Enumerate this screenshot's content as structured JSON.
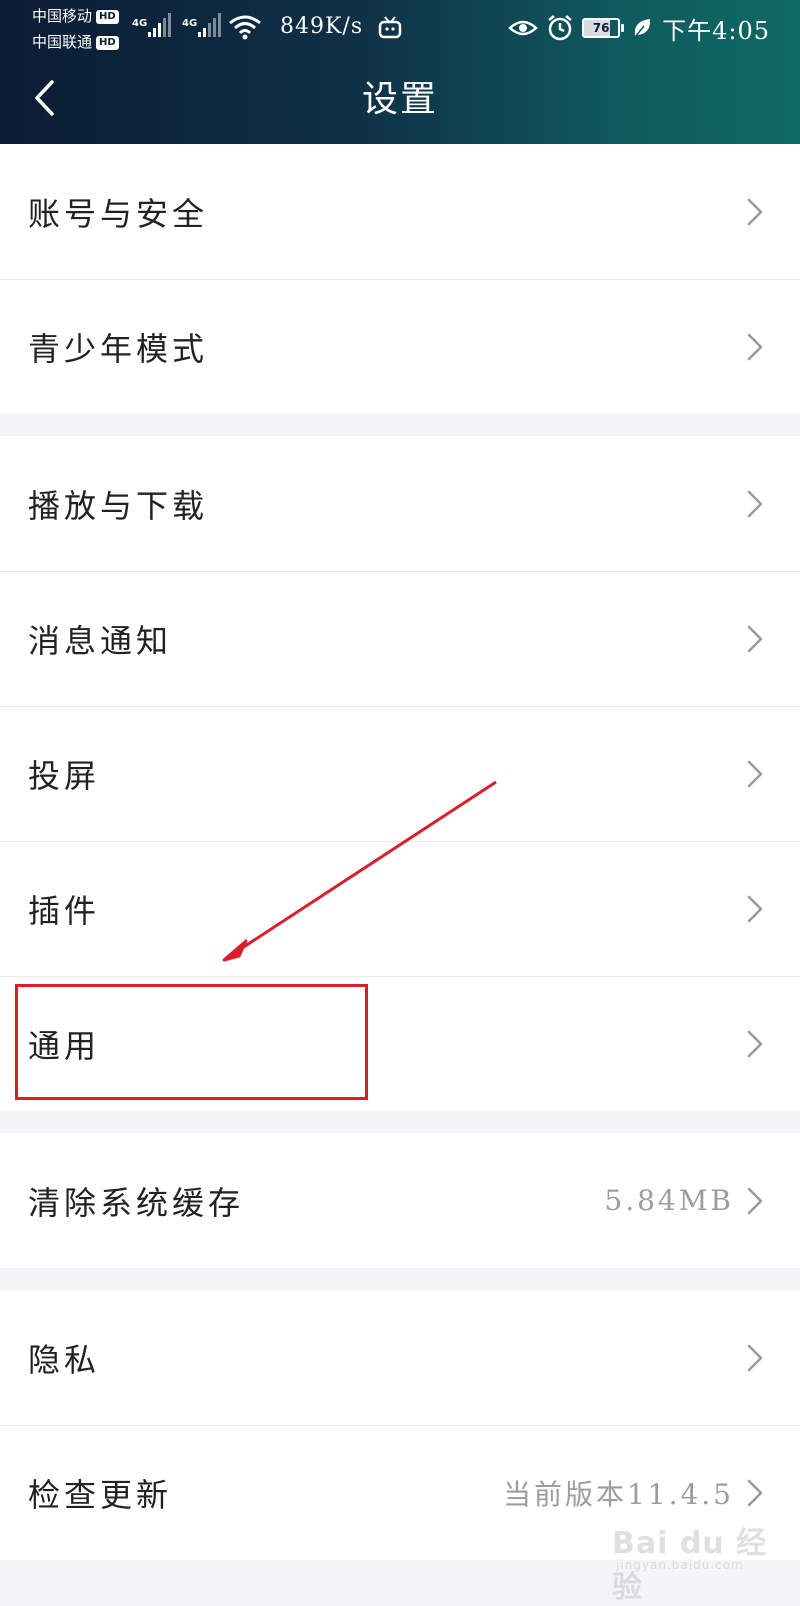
{
  "status_bar": {
    "carrier_1": "中国移动",
    "carrier_2": "中国联通",
    "hd_badge": "HD",
    "network_1": "4G",
    "network_2": "4G",
    "speed": "849K/s",
    "battery": "76",
    "time": "下午4:05",
    "icons": [
      "signal-icon",
      "wifi-icon",
      "tv-icon",
      "eye-icon",
      "alarm-icon",
      "battery-icon",
      "leaf-icon"
    ]
  },
  "header": {
    "title": "设置",
    "back_icon": "chevron-left-icon"
  },
  "groups": [
    {
      "items": [
        {
          "label": "账号与安全",
          "value": ""
        },
        {
          "label": "青少年模式",
          "value": ""
        }
      ]
    },
    {
      "items": [
        {
          "label": "播放与下载",
          "value": ""
        },
        {
          "label": "消息通知",
          "value": ""
        },
        {
          "label": "投屏",
          "value": ""
        },
        {
          "label": "插件",
          "value": ""
        },
        {
          "label": "通用",
          "value": ""
        }
      ]
    },
    {
      "items": [
        {
          "label": "清除系统缓存",
          "value": "5.84MB"
        }
      ]
    },
    {
      "items": [
        {
          "label": "隐私",
          "value": ""
        },
        {
          "label": "检查更新",
          "value": "当前版本11.4.5"
        }
      ]
    }
  ],
  "annotation": {
    "highlighted_item": "通用",
    "color": "#d9202a"
  },
  "watermark": {
    "main": "Bai du 经验",
    "sub": "jingyan.baidu.com"
  },
  "colors": {
    "header_start": "#0b1c34",
    "header_end": "#0f6b63",
    "background": "#f4f5f8",
    "row_text": "#222222",
    "value_text": "#9d9d9d"
  }
}
